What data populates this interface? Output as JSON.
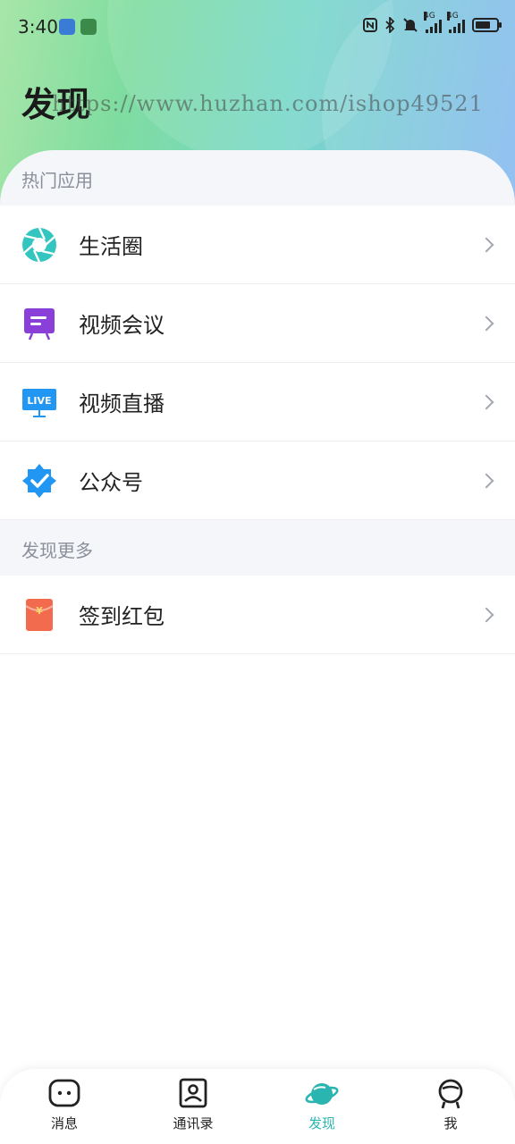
{
  "status_bar": {
    "time": "3:40",
    "network_tag_1": "4G",
    "network_tag_2": "4G"
  },
  "header": {
    "title": "发现",
    "watermark": "https://www.huzhan.com/ishop49521"
  },
  "sections": {
    "hot_apps_label": "热门应用",
    "more_label": "发现更多"
  },
  "hot_apps": [
    {
      "label": "生活圈",
      "icon": "aperture-icon"
    },
    {
      "label": "视频会议",
      "icon": "meeting-board-icon"
    },
    {
      "label": "视频直播",
      "icon": "live-tv-icon"
    },
    {
      "label": "公众号",
      "icon": "verified-badge-icon"
    }
  ],
  "more_apps": [
    {
      "label": "签到红包",
      "icon": "red-packet-icon"
    }
  ],
  "tabbar": {
    "tabs": [
      {
        "label": "消息",
        "icon": "chat-icon"
      },
      {
        "label": "通讯录",
        "icon": "contacts-icon"
      },
      {
        "label": "发现",
        "icon": "planet-icon",
        "active": true
      },
      {
        "label": "我",
        "icon": "profile-icon"
      }
    ]
  },
  "colors": {
    "accent": "#2bb5b0",
    "purple": "#8b3fd9",
    "blue": "#2196f3",
    "red": "#f26b4f"
  }
}
